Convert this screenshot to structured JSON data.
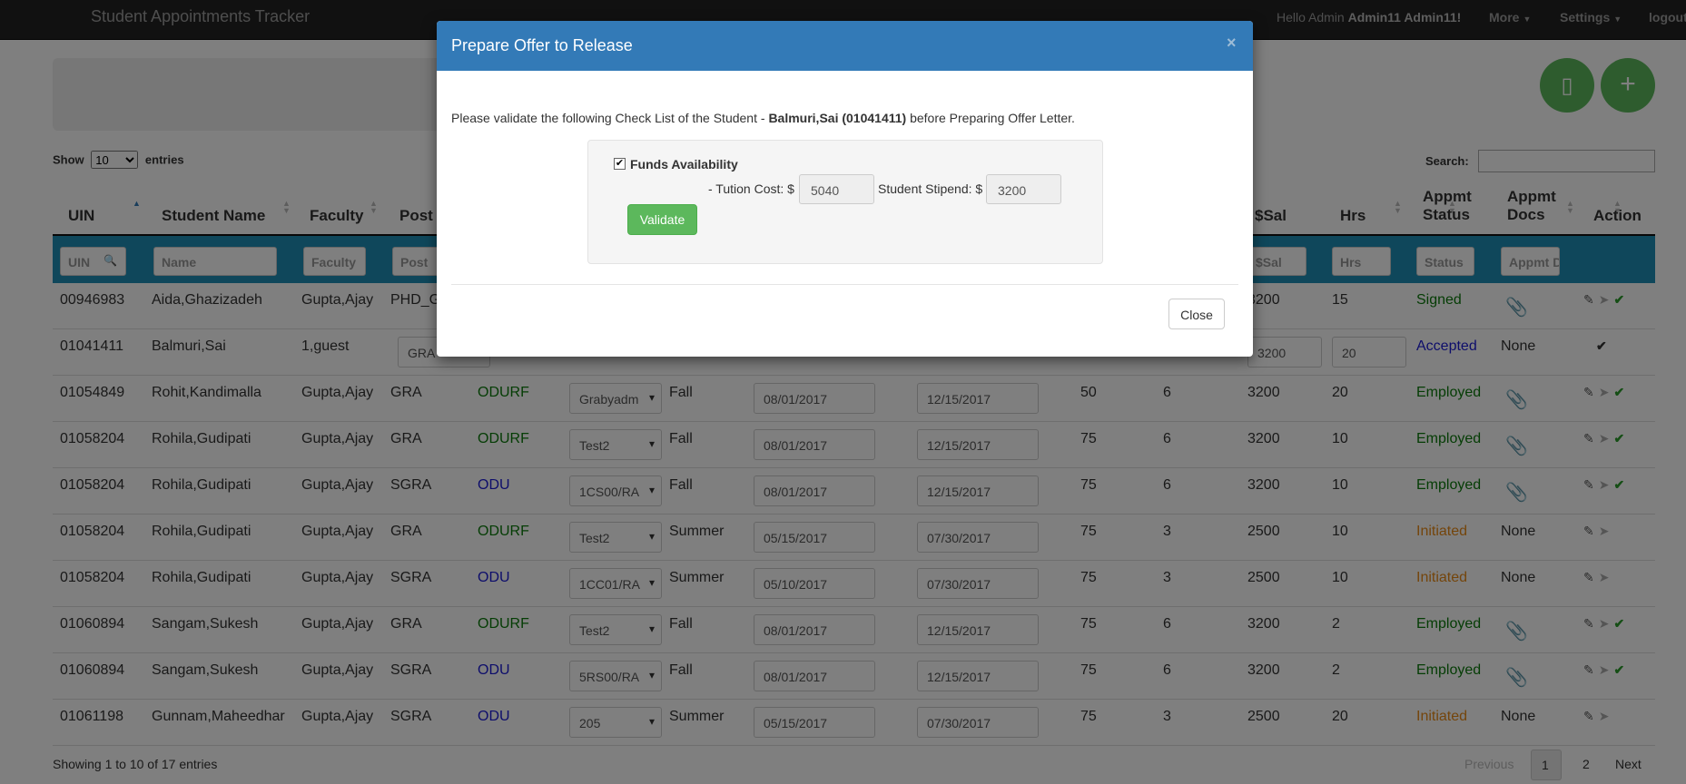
{
  "navbar": {
    "brand": "Student Appointments Tracker",
    "hello_prefix": "Hello Admin ",
    "hello_name": "Admin11 Admin11!",
    "more": "More",
    "settings": "Settings",
    "logout": "logout"
  },
  "controls": {
    "show_label": "Show",
    "entries_value": "10",
    "entries_label": "entries",
    "search_label": "Search:",
    "search_value": ""
  },
  "columns": [
    "UIN",
    "Student Name",
    "Faculty",
    "Post",
    "$Sal",
    "Hrs",
    "Appmt Status",
    "Appmt Docs",
    "Action"
  ],
  "filters": {
    "uin": "UIN",
    "name": "Name",
    "faculty": "Faculty",
    "post": "Post",
    "sal": "$Sal",
    "hrs": "Hrs",
    "status": "Status",
    "docs": "Appmt D"
  },
  "rows": [
    {
      "uin": "00946983",
      "name": "Aida,Ghazizadeh",
      "faculty": "Gupta,Ajay",
      "post": "PHD_G",
      "fund": "",
      "acct": "",
      "term": "",
      "start": "",
      "end": "",
      "pct": "",
      "mo": "",
      "sal": "3200",
      "hrs": "15",
      "status": "Signed",
      "docs": "clip",
      "actions": "full"
    },
    {
      "uin": "01041411",
      "name": "Balmuri,Sai",
      "faculty": "1,guest",
      "post": "GRA",
      "fund": "",
      "acct": "",
      "term": "",
      "start": "",
      "end": "",
      "pct": "",
      "mo": "",
      "sal": "3200",
      "hrs": "20",
      "status": "Accepted",
      "docs": "None",
      "actions": "check"
    },
    {
      "uin": "01054849",
      "name": "Rohit,Kandimalla",
      "faculty": "Gupta,Ajay",
      "post": "GRA",
      "fund": "ODURF",
      "acct": "Grabyadm",
      "term": "Fall",
      "start": "08/01/2017",
      "end": "12/15/2017",
      "pct": "50",
      "mo": "6",
      "sal": "3200",
      "hrs": "20",
      "status": "Employed",
      "docs": "clip",
      "actions": "full"
    },
    {
      "uin": "01058204",
      "name": "Rohila,Gudipati",
      "faculty": "Gupta,Ajay",
      "post": "GRA",
      "fund": "ODURF",
      "acct": "Test2",
      "term": "Fall",
      "start": "08/01/2017",
      "end": "12/15/2017",
      "pct": "75",
      "mo": "6",
      "sal": "3200",
      "hrs": "10",
      "status": "Employed",
      "docs": "clip",
      "actions": "full"
    },
    {
      "uin": "01058204",
      "name": "Rohila,Gudipati",
      "faculty": "Gupta,Ajay",
      "post": "SGRA",
      "fund": "ODU",
      "acct": "1CS00/RA",
      "term": "Fall",
      "start": "08/01/2017",
      "end": "12/15/2017",
      "pct": "75",
      "mo": "6",
      "sal": "3200",
      "hrs": "10",
      "status": "Employed",
      "docs": "clip",
      "actions": "full"
    },
    {
      "uin": "01058204",
      "name": "Rohila,Gudipati",
      "faculty": "Gupta,Ajay",
      "post": "GRA",
      "fund": "ODURF",
      "acct": "Test2",
      "term": "Summer",
      "start": "05/15/2017",
      "end": "07/30/2017",
      "pct": "75",
      "mo": "3",
      "sal": "2500",
      "hrs": "10",
      "status": "Initiated",
      "docs": "None",
      "actions": "edit"
    },
    {
      "uin": "01058204",
      "name": "Rohila,Gudipati",
      "faculty": "Gupta,Ajay",
      "post": "SGRA",
      "fund": "ODU",
      "acct": "1CC01/RA",
      "term": "Summer",
      "start": "05/10/2017",
      "end": "07/30/2017",
      "pct": "75",
      "mo": "3",
      "sal": "2500",
      "hrs": "10",
      "status": "Initiated",
      "docs": "None",
      "actions": "edit"
    },
    {
      "uin": "01060894",
      "name": "Sangam,Sukesh",
      "faculty": "Gupta,Ajay",
      "post": "GRA",
      "fund": "ODURF",
      "acct": "Test2",
      "term": "Fall",
      "start": "08/01/2017",
      "end": "12/15/2017",
      "pct": "75",
      "mo": "6",
      "sal": "3200",
      "hrs": "2",
      "status": "Employed",
      "docs": "clip",
      "actions": "full"
    },
    {
      "uin": "01060894",
      "name": "Sangam,Sukesh",
      "faculty": "Gupta,Ajay",
      "post": "SGRA",
      "fund": "ODU",
      "acct": "5RS00/RA",
      "term": "Fall",
      "start": "08/01/2017",
      "end": "12/15/2017",
      "pct": "75",
      "mo": "6",
      "sal": "3200",
      "hrs": "2",
      "status": "Employed",
      "docs": "clip",
      "actions": "full"
    },
    {
      "uin": "01061198",
      "name": "Gunnam,Maheedhar",
      "faculty": "Gupta,Ajay",
      "post": "SGRA",
      "fund": "ODU",
      "acct": "205",
      "term": "Summer",
      "start": "05/15/2017",
      "end": "07/30/2017",
      "pct": "75",
      "mo": "3",
      "sal": "2500",
      "hrs": "20",
      "status": "Initiated",
      "docs": "None",
      "actions": "edit"
    }
  ],
  "footer": {
    "info": "Showing 1 to 10 of 17 entries",
    "previous": "Previous",
    "page1": "1",
    "page2": "2",
    "next": "Next"
  },
  "modal": {
    "title": "Prepare Offer to Release",
    "close_x": "×",
    "msg_prefix": "Please validate the following Check List of the Student - ",
    "msg_student": "Balmuri,Sai (01041411)",
    "msg_suffix": " before Preparing Offer Letter.",
    "funds_label": "Funds Availability",
    "funds_checked": true,
    "tution_label": "- Tution Cost: $",
    "tution_value": "5040",
    "stipend_label": "Student Stipend: $",
    "stipend_value": "3200",
    "validate_label": "Validate",
    "close_label": "Close"
  },
  "colors": {
    "navbar": "#222222",
    "modal_header": "#337ab7",
    "filter_row": "#1f8fb6",
    "success": "#5cb85c",
    "status_employed": "#3c763d",
    "status_initiated": "#e88a17",
    "status_accepted": "#1a1ad6",
    "fund_odurf": "#0b7a0b",
    "fund_odu": "#1a1ad6"
  }
}
